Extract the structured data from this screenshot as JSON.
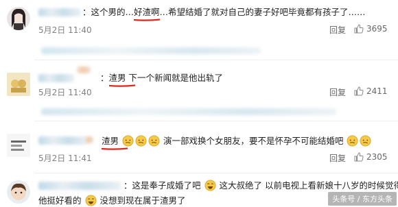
{
  "comments": [
    {
      "before": "：这个男的…",
      "highlight": "好渣啊",
      "after": "…希望结婚了就对自己的妻子好吧毕竟都有孩子了……",
      "time": "5月2日 11:40",
      "reply": "回复",
      "likes": "3695"
    },
    {
      "before": "：",
      "highlight": "渣男",
      "after": "下一个新闻就是他出轨了",
      "time": "5月2日 11:40",
      "reply": "回复",
      "likes": "2411"
    },
    {
      "before": "：",
      "highlight": "渣男",
      "after": "演一部戏换个女朋友，要不是怀孕不可能结婚吧",
      "time": "5月2日 11:41",
      "reply": "回复",
      "likes": "2305"
    },
    {
      "line1_a": "：这是奉子成婚了吧",
      "line1_b": "这大叔绝了 以前电视上看新娘十八岁的时候觉得",
      "line2_a": "他挺好看的",
      "line2_b": "没想到现在属于渣男了"
    }
  ],
  "watermark": "头条号 / 东方头条",
  "colors": {
    "underline": "#d9281e",
    "link_blue": "#eb7350"
  }
}
